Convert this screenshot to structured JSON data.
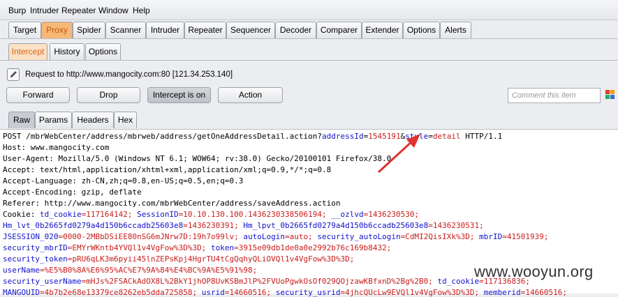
{
  "menu": [
    "Burp",
    "Intruder",
    "Repeater",
    "Window",
    "Help"
  ],
  "main_tabs": [
    "Target",
    "Proxy",
    "Spider",
    "Scanner",
    "Intruder",
    "Repeater",
    "Sequencer",
    "Decoder",
    "Comparer",
    "Extender",
    "Options",
    "Alerts"
  ],
  "proxy_tabs": [
    "Intercept",
    "History",
    "Options"
  ],
  "request_info": "Request to http://www.mangocity.com:80  [121.34.253.140]",
  "buttons": {
    "forward": "Forward",
    "drop": "Drop",
    "intercept": "Intercept is on",
    "action": "Action"
  },
  "comment_placeholder": "Comment this item",
  "view_tabs": [
    "Raw",
    "Params",
    "Headers",
    "Hex"
  ],
  "request": {
    "l1": {
      "a": "POST /mbrWebCenter/address/mbrweb/address/getOneAddressDetail.action?",
      "n1": "addressId",
      "e1": "=",
      "v1": "1545191",
      "amp": "&",
      "n2": "style",
      "e2": "=",
      "v2": "detail",
      "b": " HTTP/1.1"
    },
    "l2": "Host: www.mangocity.com",
    "l3": "User-Agent: Mozilla/5.0 (Windows NT 6.1; WOW64; rv:38.0) Gecko/20100101 Firefox/38.0",
    "l4": "Accept: text/html,application/xhtml+xml,application/xml;q=0.9,*/*;q=0.8",
    "l5": "Accept-Language: zh-CN,zh;q=0.8,en-US;q=0.5,en;q=0.3",
    "l6": "Accept-Encoding: gzip, deflate",
    "l7": "Referer: http://www.mangocity.com/mbrWebCenter/address/saveAddress.action",
    "l8": {
      "a": "Cookie: ",
      "n1": "td_cookie",
      "v1": "=117164142; ",
      "n2": "SessionID",
      "v2": "=10.10.130.100.1436230338506194; ",
      "n3": "__ozlvd",
      "v3": "=1436230530;"
    },
    "l9": {
      "n1": "Hm_lvt_0b2665fd0279a4d150b6ccadb25603e8",
      "v1": "=1436230391; ",
      "n2": "Hm_lpvt_0b2665fd0279a4d150b6ccadb25603e8",
      "v2": "=1436230531;"
    },
    "l10": {
      "n1": "JSESSION_020",
      "v1": "=0000-2MBbDSiEE80nSG6mJNrw7D:19h7o99lv; ",
      "n2": "autoLogin",
      "v2": "=auto; ",
      "n3": "security_autoLogin",
      "v3": "=CdMI2QisIXk%3D; ",
      "n4": "mbrID",
      "v4": "=41501939;"
    },
    "l11": {
      "n1": "security_mbrID",
      "v1": "=EMYrWKntb4YVQl1v4VgFow%3D%3D; ",
      "n2": "token",
      "v2": "=3915e09db1de0a0e2992b76c169b8432;"
    },
    "l12": {
      "n1": "security_token",
      "v1": "=pRU6qLK3m6pyii45lnZEPsKpj4HgrTU4tCgQqhyQLiOVQl1v4VgFow%3D%3D;"
    },
    "l13": {
      "n1": "userName",
      "v1": "=%E5%B0%8A%E6%95%AC%E7%9A%84%E4%BC%9A%E5%91%98;"
    },
    "l14": {
      "n1": "security_userName",
      "v1": "=mHJs%2FSACkAdOX8L%2BkY1jhOP8UvKSBmJlP%2FVUoPgwkOsOf029QOjzawKBfxnD%2Bg%2B0; ",
      "n2": "td_cookie",
      "v2": "=117136836;"
    },
    "l15": {
      "n1": "MANGOUID",
      "v1": "=4b7b2e68e13379ce8262eb5dda725858; ",
      "n2": "usrid",
      "v2": "=14660516; ",
      "n3": "security_usrid",
      "v3": "=4jhcQUcLw9EVQl1v4VgFow%3D%3D; ",
      "n4": "memberid",
      "v4": "=14660516;"
    }
  },
  "watermark": "www.wooyun.org",
  "colors": {
    "accent": "#f6b876",
    "param_name": "#1111cc",
    "param_value": "#c91c1c",
    "arrow": "#e0322f"
  },
  "icons": [
    "pencil-icon",
    "color-palette-icon",
    "red-arrow-annotation"
  ]
}
